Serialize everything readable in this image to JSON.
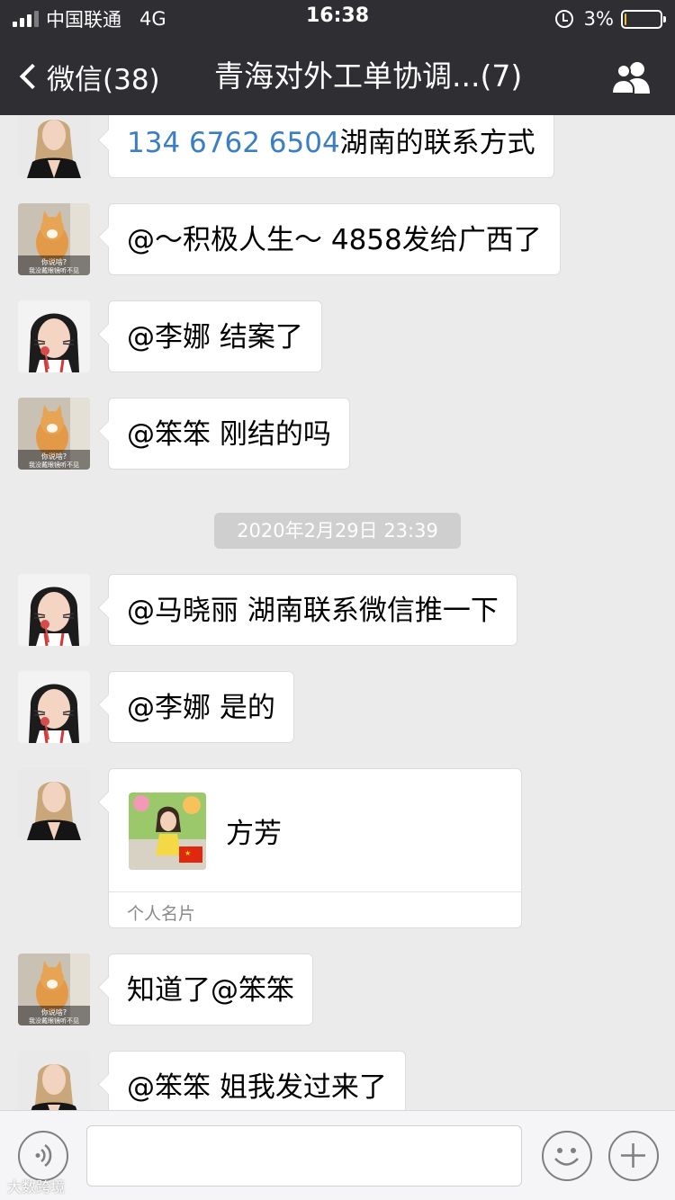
{
  "status_bar": {
    "carrier": "中国联通",
    "network": "4G",
    "time": "16:38",
    "battery": "3%",
    "battery_level": 0.03,
    "signal_bars_filled": 3,
    "signal_bars_total": 4
  },
  "nav": {
    "back_label": "微信(38)",
    "title": "青海对外工单协调...(7)",
    "icons": {
      "back": "chevron-left-icon",
      "members": "group-members-icon"
    }
  },
  "messages": [
    {
      "avatar": "avatar-woman-blonde",
      "link": "134 6762 6504",
      "text": "湖南的联系方式"
    },
    {
      "avatar": "avatar-cat",
      "text": "@～积极人生～ 4858发给广西了"
    },
    {
      "avatar": "avatar-girl-cat-filter",
      "text": "@李娜 结案了"
    },
    {
      "avatar": "avatar-cat",
      "text": "@笨笨 刚结的吗"
    },
    {
      "avatar": "avatar-girl-cat-filter",
      "text": "@马晓丽 湖南联系微信推一下"
    },
    {
      "avatar": "avatar-girl-cat-filter",
      "text": "@李娜 是的"
    },
    {
      "avatar": "avatar-woman-blonde",
      "card": {
        "name": "方芳",
        "type_label": "个人名片"
      }
    },
    {
      "avatar": "avatar-cat",
      "text": "知道了@笨笨"
    },
    {
      "avatar": "avatar-woman-blonde",
      "text": "@笨笨 姐我发过来了"
    }
  ],
  "timestamp": "2020年2月29日 23:39",
  "cat_avatar_caption": [
    "你说啥?",
    "我没戴眼镜听不见"
  ],
  "input_bar": {
    "icons": {
      "voice": "voice-icon",
      "emoji": "emoji-icon",
      "more": "plus-icon"
    }
  },
  "watermark": "大数跨境",
  "colors": {
    "header": "#2e2e33",
    "chat_bg": "#ebebeb",
    "bubble": "#ffffff",
    "link": "#3a7fc4",
    "battery": "#e6c23a"
  }
}
